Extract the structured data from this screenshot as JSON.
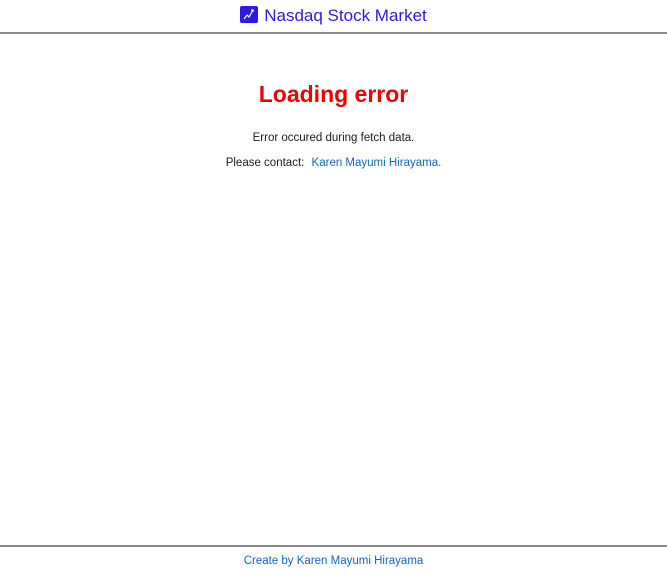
{
  "header": {
    "title": "Nasdaq Stock Market",
    "icon": "chart-line-icon",
    "icon_color": "#2f18e6"
  },
  "main": {
    "error_title": "Loading error",
    "error_message": "Error occured during fetch data.",
    "contact_prefix": "Please contact:",
    "contact_name": "Karen Mayumi Hirayama."
  },
  "footer": {
    "credit": "Create by Karen Mayumi Hirayama"
  },
  "colors": {
    "brand": "#2f18e6",
    "error": "#ee0000",
    "link": "#1565c0",
    "divider": "#8a8a8a"
  }
}
